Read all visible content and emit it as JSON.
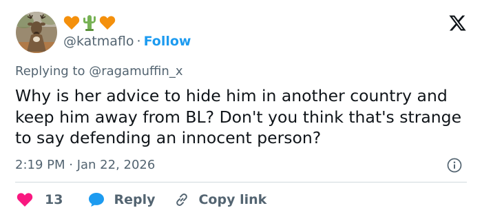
{
  "header": {
    "handle": "@katmaflo",
    "separator": "·",
    "follow_label": "Follow",
    "emojis": [
      "orange-heart",
      "cactus",
      "orange-heart"
    ]
  },
  "reply": {
    "prefix": "Replying to ",
    "mention": "@ragamuffin_x"
  },
  "tweet": {
    "text": "Why is her advice to hide him in another country and keep him away from BL? Don't you think that's strange to say defending an innocent person?",
    "timestamp": "2:19 PM · Jan 22, 2026"
  },
  "actions": {
    "like_count": "13",
    "reply_label": "Reply",
    "copy_link_label": "Copy link"
  },
  "colors": {
    "accent": "#1d9bf0",
    "like": "#f91880",
    "secondary_text": "#536471",
    "primary_text": "#0f1419",
    "divider": "#cfd9de",
    "emoji_heart": "#f4900c",
    "emoji_cactus": "#77b255"
  }
}
